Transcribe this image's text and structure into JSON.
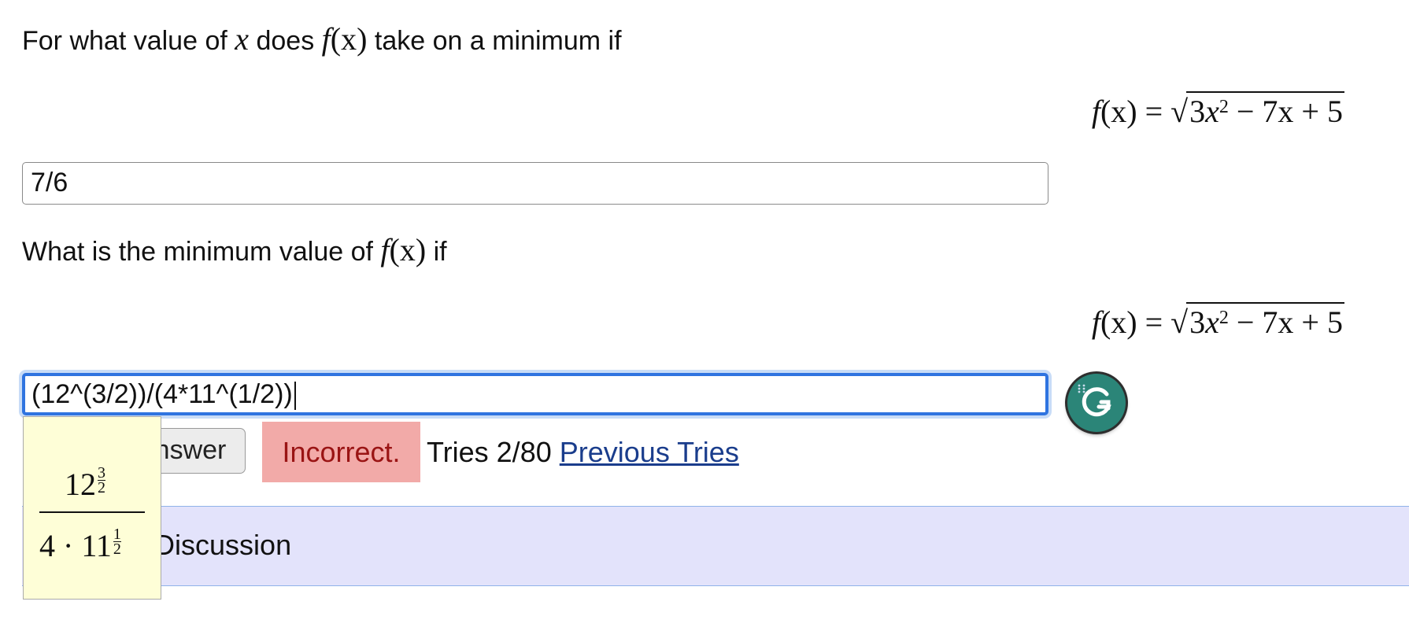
{
  "question1": {
    "prefix": "For what value of",
    "var": "x",
    "mid": "does",
    "fn": "f",
    "arg": "(x)",
    "suffix": "take on a minimum if"
  },
  "equation": {
    "lhs_f": "f",
    "lhs_arg": "(x)",
    "equals": "=",
    "coef": "3",
    "var": "x",
    "exp": "2",
    "rest": "− 7x + 5"
  },
  "answer1": {
    "value": "7/6"
  },
  "question2": {
    "prefix": "What is the minimum value of",
    "fn": "f",
    "arg": "(x)",
    "suffix": "if"
  },
  "answer2": {
    "value": "(12^(3/2))/(4*11^(1/2))"
  },
  "preview": {
    "num_base": "12",
    "num_exp_n": "3",
    "num_exp_d": "2",
    "den_prefix": "4 · 11",
    "den_exp_n": "1",
    "den_exp_d": "2"
  },
  "actions": {
    "submit_label": "Submit Answer",
    "status": "Incorrect.",
    "tries": "Tries 2/80",
    "previous_tries_label": "Previous Tries"
  },
  "discussion": {
    "label": "Post Discussion"
  },
  "colors": {
    "focus_border": "#2f74e0",
    "incorrect_bg": "#f2aaa8",
    "incorrect_text": "#9a1414",
    "discussion_bg": "#e3e3fb",
    "preview_bg": "#fefed7",
    "grammarly": "#2b8578"
  }
}
